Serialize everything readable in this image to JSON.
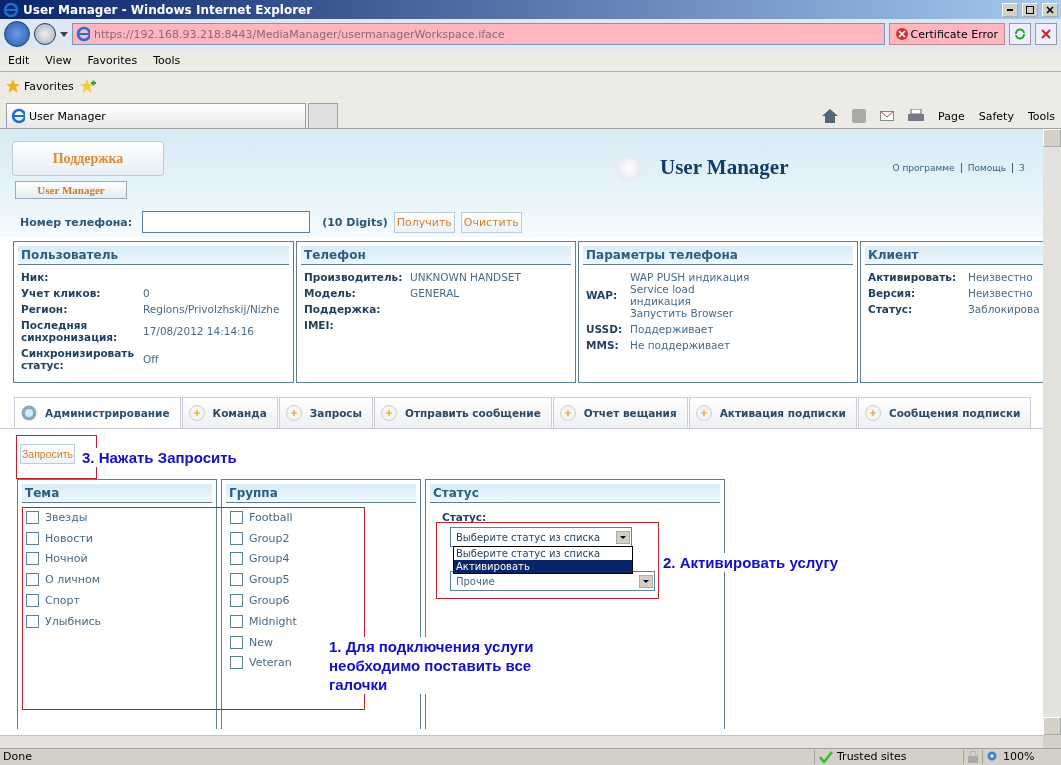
{
  "window": {
    "title": "User Manager - Windows Internet Explorer"
  },
  "address_bar": {
    "url": "https://192.168.93.218:8443/MediaManager/usermanagerWorkspace.iface",
    "certificate": "Certificate Error"
  },
  "menu": [
    "Edit",
    "View",
    "Favorites",
    "Tools"
  ],
  "favorites_bar": {
    "label": "Favorites"
  },
  "browser_tabs": [
    {
      "title": "User Manager",
      "selected": true
    }
  ],
  "command_bar": [
    "Page",
    "Safety",
    "Tools"
  ],
  "page": {
    "brand_button": "Поддержка",
    "sub_tab": "User Manager",
    "app_title": "User Manager",
    "header_links": [
      "О программе",
      "Помощь",
      "З"
    ],
    "phone": {
      "label": "Номер телефона:",
      "hint": "(10 Digits)",
      "buttons": [
        "Получить",
        "Очистить"
      ]
    },
    "panels": [
      {
        "title": "Пользователь",
        "rows": [
          {
            "label": "Ник:"
          },
          {
            "label": "Учет кликов:",
            "lines": [
              "0"
            ]
          },
          {
            "label": "Регион:",
            "lines": [
              "Regions/Privolzhskij/Nizhe"
            ]
          },
          {
            "label": "Последняя синхронизация:",
            "lines": [
              "17/08/2012 14:14:16"
            ]
          },
          {
            "label": "Синхронизировать статус:",
            "lines": [
              "Off"
            ]
          }
        ]
      },
      {
        "title": "Телефон",
        "rows": [
          {
            "label": "Производитель:",
            "lines": [
              "UNKNOWN HANDSET"
            ]
          },
          {
            "label": "Модель:",
            "lines": [
              "GENERAL"
            ]
          },
          {
            "label": "Поддержка:"
          },
          {
            "label": "IMEI:"
          }
        ]
      },
      {
        "title": "Параметры телефона",
        "rows": [
          {
            "label": "WAP:",
            "lines": [
              "WAP PUSH индикация",
              "Service load",
              "индикация",
              "Запустить Browser"
            ]
          },
          {
            "label": "USSD:",
            "lines": [
              "Поддерживает"
            ]
          },
          {
            "label": "MMS:",
            "lines": [
              "Не поддерживает"
            ]
          }
        ]
      },
      {
        "title": "Клиент",
        "rows": [
          {
            "label": "Активировать:",
            "lines": [
              "Неизвестно"
            ]
          },
          {
            "label": "Версия:",
            "lines": [
              "Неизвестно"
            ]
          },
          {
            "label": "Статус:",
            "lines": [
              "Заблокирова"
            ]
          }
        ]
      }
    ],
    "tabs": [
      {
        "label": "Администрирование",
        "selected": true
      },
      {
        "label": "Команда",
        "selected": false
      },
      {
        "label": "Запросы",
        "selected": false
      },
      {
        "label": "Отправить сообщение",
        "selected": false
      },
      {
        "label": "Отчет вещания",
        "selected": false
      },
      {
        "label": "Активация подписки",
        "selected": false
      },
      {
        "label": "Сообщения подписки",
        "selected": false
      }
    ],
    "request_button": "Запросить",
    "topics": {
      "title": "Тема",
      "items": [
        {
          "label": "Звезды",
          "checked": false
        },
        {
          "label": "Новости",
          "checked": false
        },
        {
          "label": "Ночной",
          "checked": false
        },
        {
          "label": "О личном",
          "checked": false
        },
        {
          "label": "Спорт",
          "checked": false
        },
        {
          "label": "Улыбнись",
          "checked": false
        }
      ]
    },
    "groups": {
      "title": "Группа",
      "items": [
        {
          "label": "Football",
          "checked": false
        },
        {
          "label": "Group2",
          "checked": false
        },
        {
          "label": "Group4",
          "checked": false
        },
        {
          "label": "Group5",
          "checked": false
        },
        {
          "label": "Group6",
          "checked": false
        },
        {
          "label": "Midnight",
          "checked": false
        },
        {
          "label": "New",
          "checked": false
        },
        {
          "label": "Veteran",
          "checked": false
        }
      ]
    },
    "status_panel": {
      "title": "Статус",
      "label": "Статус:",
      "select_value": "Выберите статус из списка",
      "options": [
        {
          "label": "Выберите статус из списка",
          "selected": false
        },
        {
          "label": "Активировать",
          "selected": true
        }
      ],
      "second_select_value": "Прочие"
    },
    "annotations": [
      {
        "kind": "step3",
        "text": "3. Нажать Запросить"
      },
      {
        "kind": "step2",
        "text": "2. Активировать услугу"
      },
      {
        "kind": "step1",
        "text": "1. Для подключения услуги необходимо поставить все галочки"
      }
    ]
  },
  "status_bar": {
    "text": "Done",
    "zone": "Trusted sites",
    "zoom": "100%"
  }
}
